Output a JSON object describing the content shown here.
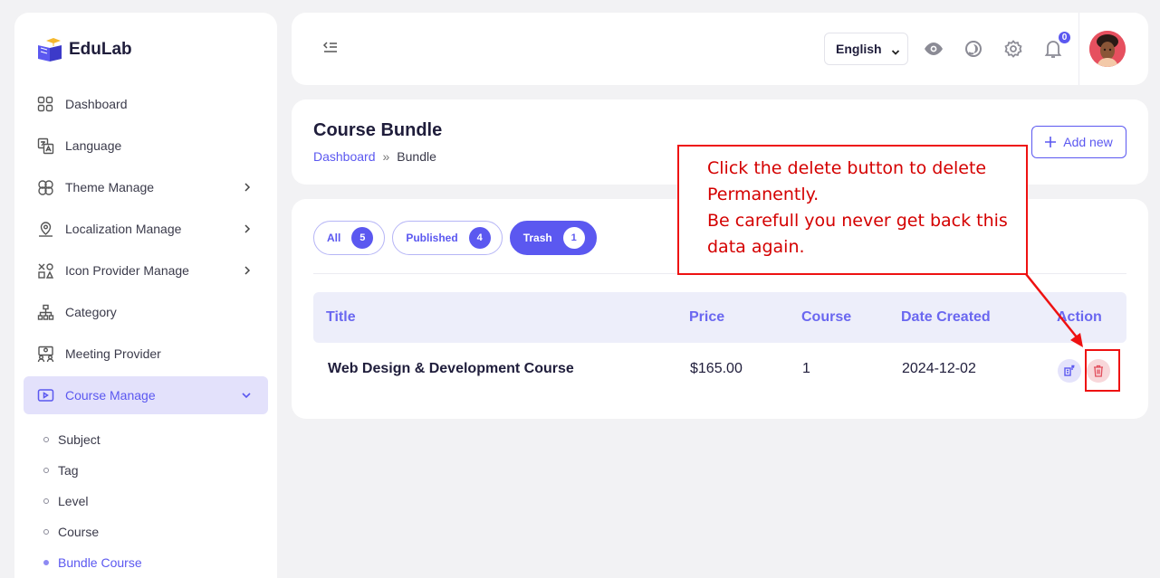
{
  "brand": {
    "name": "EduLab"
  },
  "sidebar": {
    "items": [
      {
        "label": "Dashboard",
        "icon": "grid-icon",
        "has_chevron": false
      },
      {
        "label": "Language",
        "icon": "translate-icon",
        "has_chevron": false
      },
      {
        "label": "Theme Manage",
        "icon": "theme-icon",
        "has_chevron": true
      },
      {
        "label": "Localization Manage",
        "icon": "map-pin-icon",
        "has_chevron": true
      },
      {
        "label": "Icon Provider Manage",
        "icon": "shapes-icon",
        "has_chevron": true
      },
      {
        "label": "Category",
        "icon": "hierarchy-icon",
        "has_chevron": false
      },
      {
        "label": "Meeting Provider",
        "icon": "meeting-icon",
        "has_chevron": false
      },
      {
        "label": "Course Manage",
        "icon": "video-icon",
        "has_chevron": true,
        "active": true
      }
    ],
    "subitems": [
      {
        "label": "Subject"
      },
      {
        "label": "Tag"
      },
      {
        "label": "Level"
      },
      {
        "label": "Course"
      },
      {
        "label": "Bundle Course",
        "active": true
      }
    ]
  },
  "topbar": {
    "language": "English",
    "notification_count": "0",
    "icons": [
      "menu-collapse-icon",
      "eye-icon",
      "theme-toggle-icon",
      "gear-icon",
      "bell-icon"
    ]
  },
  "page": {
    "title": "Course Bundle",
    "breadcrumb": {
      "home": "Dashboard",
      "sep": "»",
      "current": "Bundle"
    },
    "add_button": "Add new"
  },
  "tabs": [
    {
      "label": "All",
      "count": "5"
    },
    {
      "label": "Published",
      "count": "4"
    },
    {
      "label": "Trash",
      "count": "1",
      "active": true
    }
  ],
  "table": {
    "headers": {
      "title": "Title",
      "price": "Price",
      "course": "Course",
      "date": "Date Created",
      "action": "Action"
    },
    "rows": [
      {
        "title": "Web Design & Development Course",
        "price": "$165.00",
        "course": "1",
        "date": "2024-12-02"
      }
    ]
  },
  "annotation": {
    "lines": [
      "Click the delete button to delete",
      "Permanently.",
      "Be carefull you never get back this",
      "data again."
    ]
  },
  "colors": {
    "accent": "#5b58f0",
    "annotation": "#e11111",
    "delete": "#f8d7da"
  }
}
